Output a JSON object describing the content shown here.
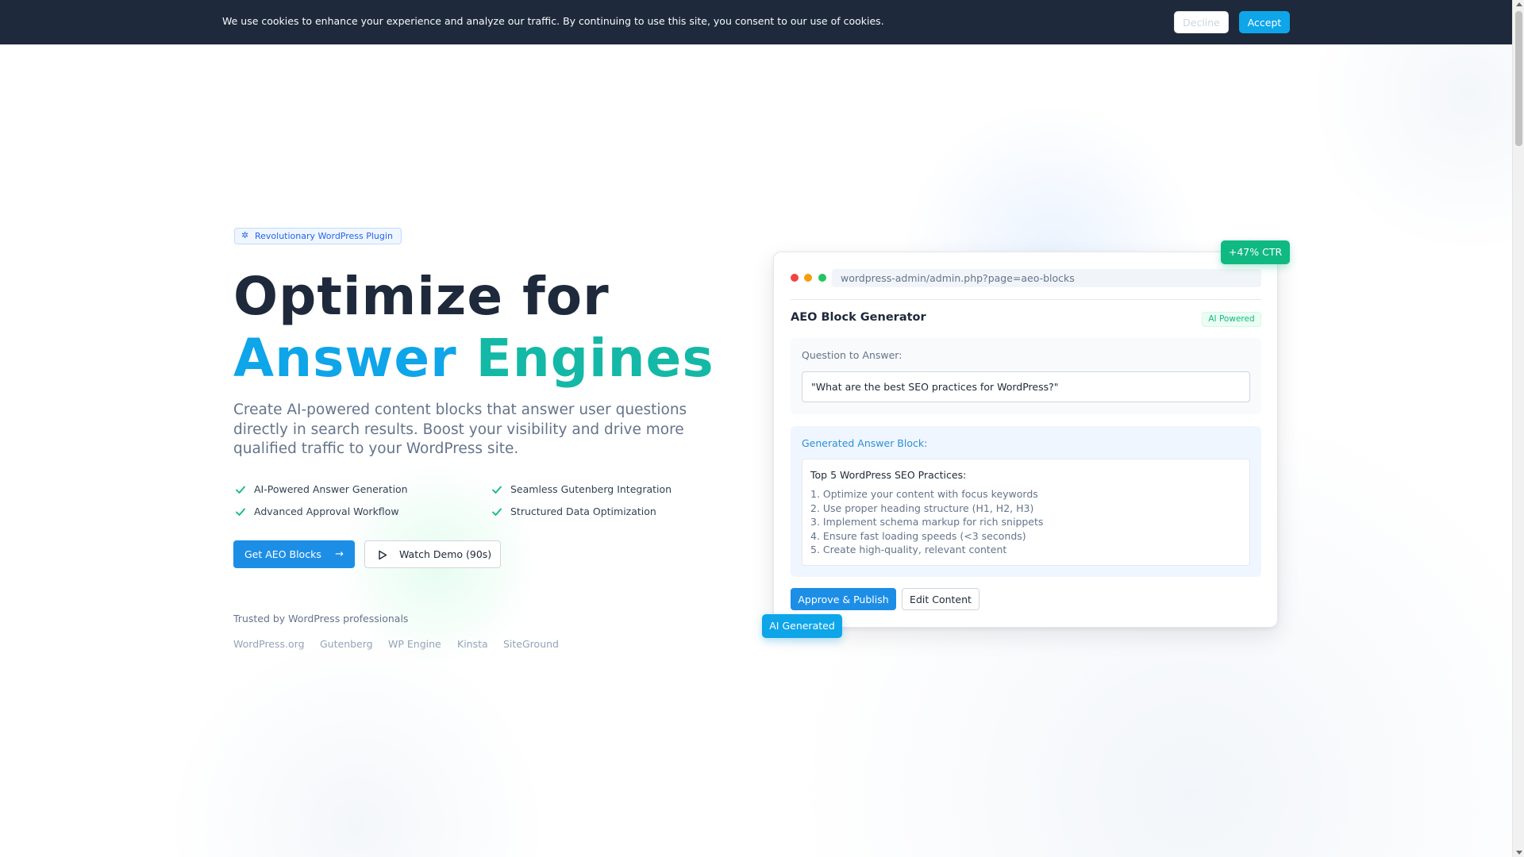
{
  "cookie_banner": {
    "message": "We use cookies to enhance your experience and analyze our traffic. By continuing to use this site, you consent to our use of cookies.",
    "decline_label": "Decline",
    "accept_label": "Accept"
  },
  "hero": {
    "badge_label": "Revolutionary WordPress Plugin",
    "headline_line1": "Optimize for",
    "headline_word1": "Answer",
    "headline_word2": "Engines",
    "subtitle": "Create AI-powered content blocks that answer user questions directly in search results. Boost your visibility and drive more qualified traffic to your WordPress site.",
    "features": [
      "AI-Powered Answer Generation",
      "Seamless Gutenberg Integration",
      "Advanced Approval Workflow",
      "Structured Data Optimization"
    ],
    "primary_cta": "Get AEO Blocks",
    "secondary_cta": "Watch Demo (90s)",
    "trusted_label": "Trusted by WordPress professionals",
    "trusted_logos": [
      "WordPress.org",
      "Gutenberg",
      "WP Engine",
      "Kinsta",
      "SiteGround"
    ]
  },
  "demo_card": {
    "url": "wordpress-admin/admin.php?page=aeo-blocks",
    "title": "AEO Block Generator",
    "ai_badge": "AI Powered",
    "question_label": "Question to Answer:",
    "question_value": "\"What are the best SEO practices for WordPress?\"",
    "answer_label": "Generated Answer Block:",
    "answer_heading": "Top 5 WordPress SEO Practices:",
    "answer_items": [
      "1. Optimize your content with focus keywords",
      "2. Use proper heading structure (H1, H2, H3)",
      "3. Implement schema markup for rich snippets",
      "4. Ensure fast loading speeds (<3 seconds)",
      "5. Create high-quality, relevant content"
    ],
    "approve_label": "Approve & Publish",
    "edit_label": "Edit Content",
    "ctr_badge": "+47% CTR",
    "ai_generated_badge": "AI Generated"
  },
  "colors": {
    "banner_bg": "#1e293b",
    "accent_blue": "#0ea5e9",
    "accent_teal": "#14b8a6",
    "success_green": "#10b981",
    "heading_dark": "#1e293b"
  },
  "icons": {
    "badge": "sparkle-icon",
    "feature": "check-icon",
    "primary_cta": "arrow-right-icon",
    "secondary_cta": "play-icon"
  }
}
